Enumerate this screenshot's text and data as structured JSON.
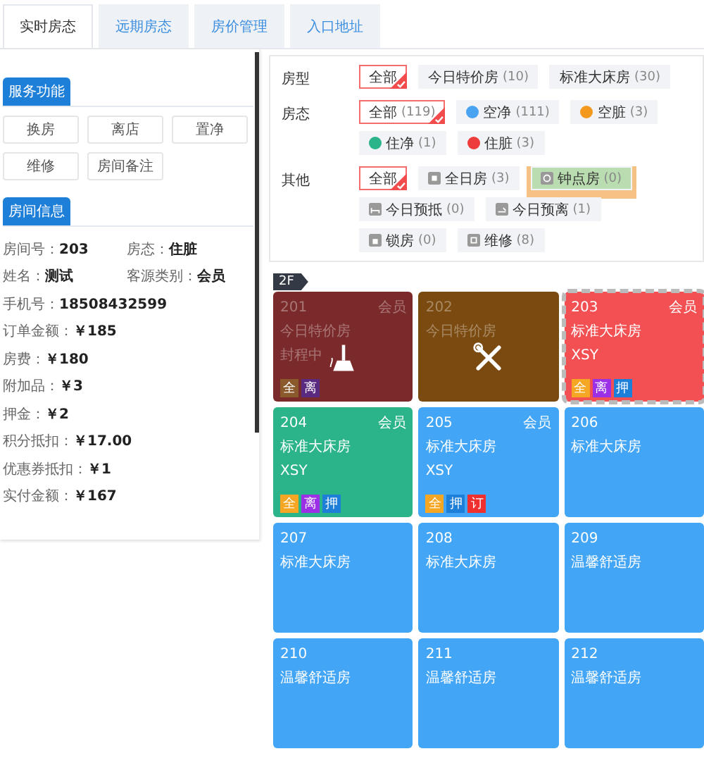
{
  "tabs": [
    {
      "label": "实时房态",
      "selected": true
    },
    {
      "label": "远期房态",
      "selected": false
    },
    {
      "label": "房价管理",
      "selected": false
    },
    {
      "label": "入口地址",
      "selected": false
    }
  ],
  "service": {
    "title": "服务功能",
    "buttons": [
      "换房",
      "离店",
      "置净",
      "维修",
      "房间备注"
    ]
  },
  "room_info": {
    "title": "房间信息",
    "rows": [
      [
        {
          "label": "房间号：",
          "value": "203"
        },
        {
          "label": "房态：",
          "value": "住脏"
        }
      ],
      [
        {
          "label": "姓名：",
          "value": "测试"
        },
        {
          "label": "客源类别：",
          "value": "会员"
        }
      ],
      [
        {
          "label": "手机号：",
          "value": "18508432599"
        }
      ],
      [
        {
          "label": "订单金额：",
          "value": "￥185"
        }
      ],
      [
        {
          "label": "房费：",
          "value": "￥180"
        }
      ],
      [
        {
          "label": "附加品：",
          "value": "￥3"
        }
      ],
      [
        {
          "label": "押金：",
          "value": "￥2"
        }
      ],
      [
        {
          "label": "积分抵扣：",
          "value": "￥17.00"
        }
      ],
      [
        {
          "label": "优惠券抵扣：",
          "value": "￥1"
        }
      ],
      [
        {
          "label": "实付金额：",
          "value": "￥167"
        }
      ]
    ]
  },
  "filters": [
    {
      "label": "房型",
      "options": [
        {
          "kind": "plain",
          "label": "全部",
          "selected": true
        },
        {
          "kind": "plain",
          "label": "今日特价房",
          "count": "(10)",
          "selected": false
        },
        {
          "kind": "plain",
          "label": "标准大床房",
          "count": "(30)",
          "selected": false
        }
      ]
    },
    {
      "label": "房态",
      "options": [
        {
          "kind": "plain",
          "label": "全部",
          "count": "(119)",
          "selected": true
        },
        {
          "kind": "dot",
          "label": "空净",
          "count": "(111)",
          "color": "#4aa3f0",
          "selected": false
        },
        {
          "kind": "dot",
          "label": "空脏",
          "count": "(3)",
          "color": "#f39a1e",
          "selected": false
        },
        {
          "kind": "dot",
          "label": "住净",
          "count": "(1)",
          "color": "#2bb38a",
          "selected": false
        },
        {
          "kind": "dot",
          "label": "住脏",
          "count": "(3)",
          "color": "#ee3b3b",
          "selected": false
        }
      ]
    },
    {
      "label": "其他",
      "options": [
        {
          "kind": "plain",
          "label": "全部",
          "selected": true,
          "highlighted": false
        },
        {
          "kind": "icon",
          "label": "全日房",
          "count": "(3)",
          "selected": false,
          "highlighted": false
        },
        {
          "kind": "icon",
          "label": "钟点房",
          "count": "(0)",
          "selected": false,
          "highlighted": true
        },
        {
          "kind": "icon",
          "label": "今日预抵",
          "count": "(0)",
          "selected": false,
          "highlighted": false
        },
        {
          "kind": "icon",
          "label": "今日预离",
          "count": "(1)",
          "selected": false,
          "highlighted": false
        },
        {
          "kind": "icon",
          "label": "锁房",
          "count": "(0)",
          "selected": false,
          "highlighted": false
        },
        {
          "kind": "icon",
          "label": "维修",
          "count": "(8)",
          "selected": false,
          "highlighted": false
        }
      ]
    }
  ],
  "floor": {
    "label": "2F",
    "rooms": [
      {
        "number": "201",
        "member": "会员",
        "lines": [
          "今日特价房",
          "封程中"
        ],
        "tags": [
          {
            "label": "全",
            "color": "#8a5a2c"
          },
          {
            "label": "离",
            "color": "#5a2a80"
          }
        ],
        "color": "#7a2a2a",
        "cleaning": true,
        "repair": false,
        "dimmed": true,
        "selected": false
      },
      {
        "number": "202",
        "lines": [
          "今日特价房"
        ],
        "color": "#7a4a10",
        "cleaning": false,
        "repair": true,
        "dimmed": true,
        "selected": false
      },
      {
        "number": "203",
        "member": "会员",
        "lines": [
          "标准大床房",
          "XSY"
        ],
        "tags": [
          {
            "label": "全",
            "color": "#f5a623"
          },
          {
            "label": "离",
            "color": "#9b30e6"
          },
          {
            "label": "押",
            "color": "#1e7fd8"
          }
        ],
        "color": "#f25053",
        "cleaning": false,
        "repair": false,
        "dimmed": false,
        "selected": true
      },
      {
        "number": "204",
        "member": "会员",
        "lines": [
          "标准大床房",
          "XSY"
        ],
        "tags": [
          {
            "label": "全",
            "color": "#f5a623"
          },
          {
            "label": "离",
            "color": "#9b30e6"
          },
          {
            "label": "押",
            "color": "#1e7fd8"
          }
        ],
        "color": "#2bb38a",
        "cleaning": false,
        "repair": false,
        "dimmed": false,
        "selected": false
      },
      {
        "number": "205",
        "member": "会员",
        "lines": [
          "标准大床房",
          "XSY"
        ],
        "tags": [
          {
            "label": "全",
            "color": "#f5a623"
          },
          {
            "label": "押",
            "color": "#1e7fd8"
          },
          {
            "label": "订",
            "color": "#f0302f"
          }
        ],
        "color": "#42a5f5",
        "cleaning": false,
        "repair": false,
        "dimmed": false,
        "selected": false
      },
      {
        "number": "206",
        "lines": [
          "标准大床房"
        ],
        "color": "#42a5f5",
        "cleaning": false,
        "repair": false,
        "dimmed": false,
        "selected": false
      },
      {
        "number": "207",
        "lines": [
          "标准大床房"
        ],
        "color": "#42a5f5",
        "cleaning": false,
        "repair": false,
        "dimmed": false,
        "selected": false
      },
      {
        "number": "208",
        "lines": [
          "标准大床房"
        ],
        "color": "#42a5f5",
        "cleaning": false,
        "repair": false,
        "dimmed": false,
        "selected": false
      },
      {
        "number": "209",
        "lines": [
          "温馨舒适房"
        ],
        "color": "#42a5f5",
        "cleaning": false,
        "repair": false,
        "dimmed": false,
        "selected": false
      },
      {
        "number": "210",
        "lines": [
          "温馨舒适房"
        ],
        "color": "#42a5f5",
        "cleaning": false,
        "repair": false,
        "dimmed": false,
        "selected": false
      },
      {
        "number": "211",
        "lines": [
          "温馨舒适房"
        ],
        "color": "#42a5f5",
        "cleaning": false,
        "repair": false,
        "dimmed": false,
        "selected": false
      },
      {
        "number": "212",
        "lines": [
          "温馨舒适房"
        ],
        "color": "#42a5f5",
        "cleaning": false,
        "repair": false,
        "dimmed": false,
        "selected": false
      }
    ]
  }
}
